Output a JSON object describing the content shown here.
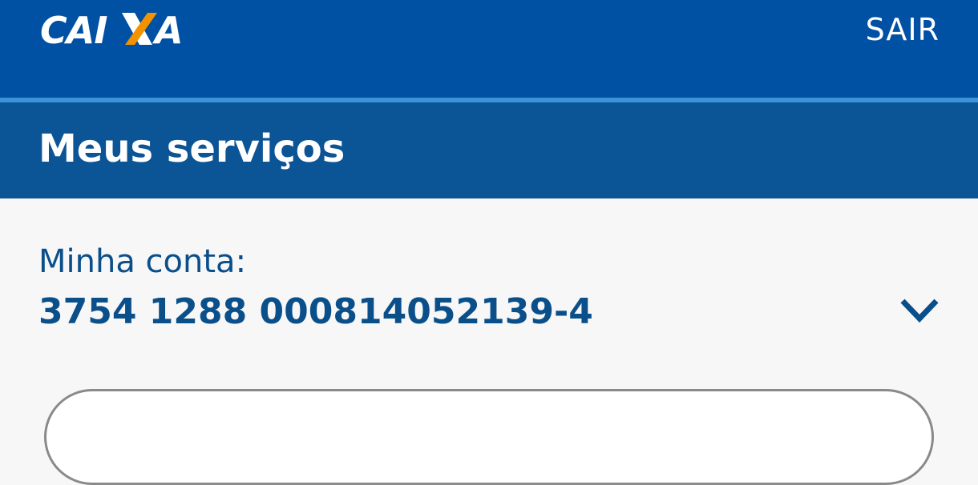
{
  "header": {
    "logo_text": "CAIXA",
    "logout_label": "SAIR",
    "colors": {
      "primary": "#0050a3",
      "accent_line": "#3c93d6",
      "logo_orange": "#f39200"
    }
  },
  "section": {
    "title": "Meus serviços",
    "color": "#0b5496"
  },
  "account": {
    "label": "Minha conta:",
    "number": "3754 1288 000814052139-4",
    "dropdown_icon": "chevron-down-icon"
  }
}
